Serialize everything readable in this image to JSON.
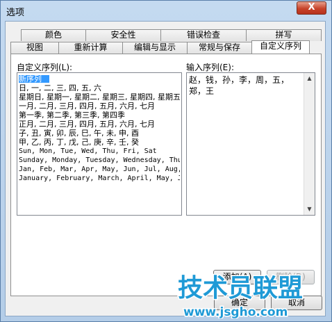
{
  "window": {
    "title": "选项",
    "close_glyph": "X"
  },
  "tabs_row1": [
    "颜色",
    "安全性",
    "错误检查",
    "拼写"
  ],
  "tabs_row2": [
    "视图",
    "重新计算",
    "编辑与显示",
    "常规与保存",
    "自定义序列"
  ],
  "active_tab": "自定义序列",
  "custom_lists": {
    "label": "自定义序列(L):",
    "items": [
      "新序列",
      "日, 一, 二, 三, 四, 五, 六",
      "星期日, 星期一, 星期二, 星期三, 星期四, 星期五",
      "一月, 二月, 三月, 四月, 五月, 六月, 七月",
      "第一季, 第二季, 第三季, 第四季",
      "正月, 二月, 三月, 四月, 五月, 六月, 七月",
      "子, 丑, 寅, 卯, 辰, 巳, 午, 未, 申, 酉",
      "甲, 乙, 丙, 丁, 戊, 己, 庚, 辛, 壬, 癸",
      "Sun, Mon, Tue, Wed, Thu, Fri, Sat",
      "Sunday, Monday, Tuesday, Wednesday, Thu",
      "Jan, Feb, Mar, Apr, May, Jun, Jul, Aug,",
      "January, February, March, April, May, J"
    ],
    "selected_index": 0
  },
  "input_entries": {
    "label": "输入序列(E):",
    "value": "赵，钱，孙，李，周，五，郑，王"
  },
  "buttons": {
    "add": "添加(A)",
    "delete": "删除(D)",
    "ok": "确定",
    "cancel": "取消"
  },
  "watermark": {
    "main": "技术员联盟",
    "url": "www.jsgho.com",
    "colors": {
      "main": "#1f9ad6",
      "url": "#1f9ad6"
    }
  }
}
